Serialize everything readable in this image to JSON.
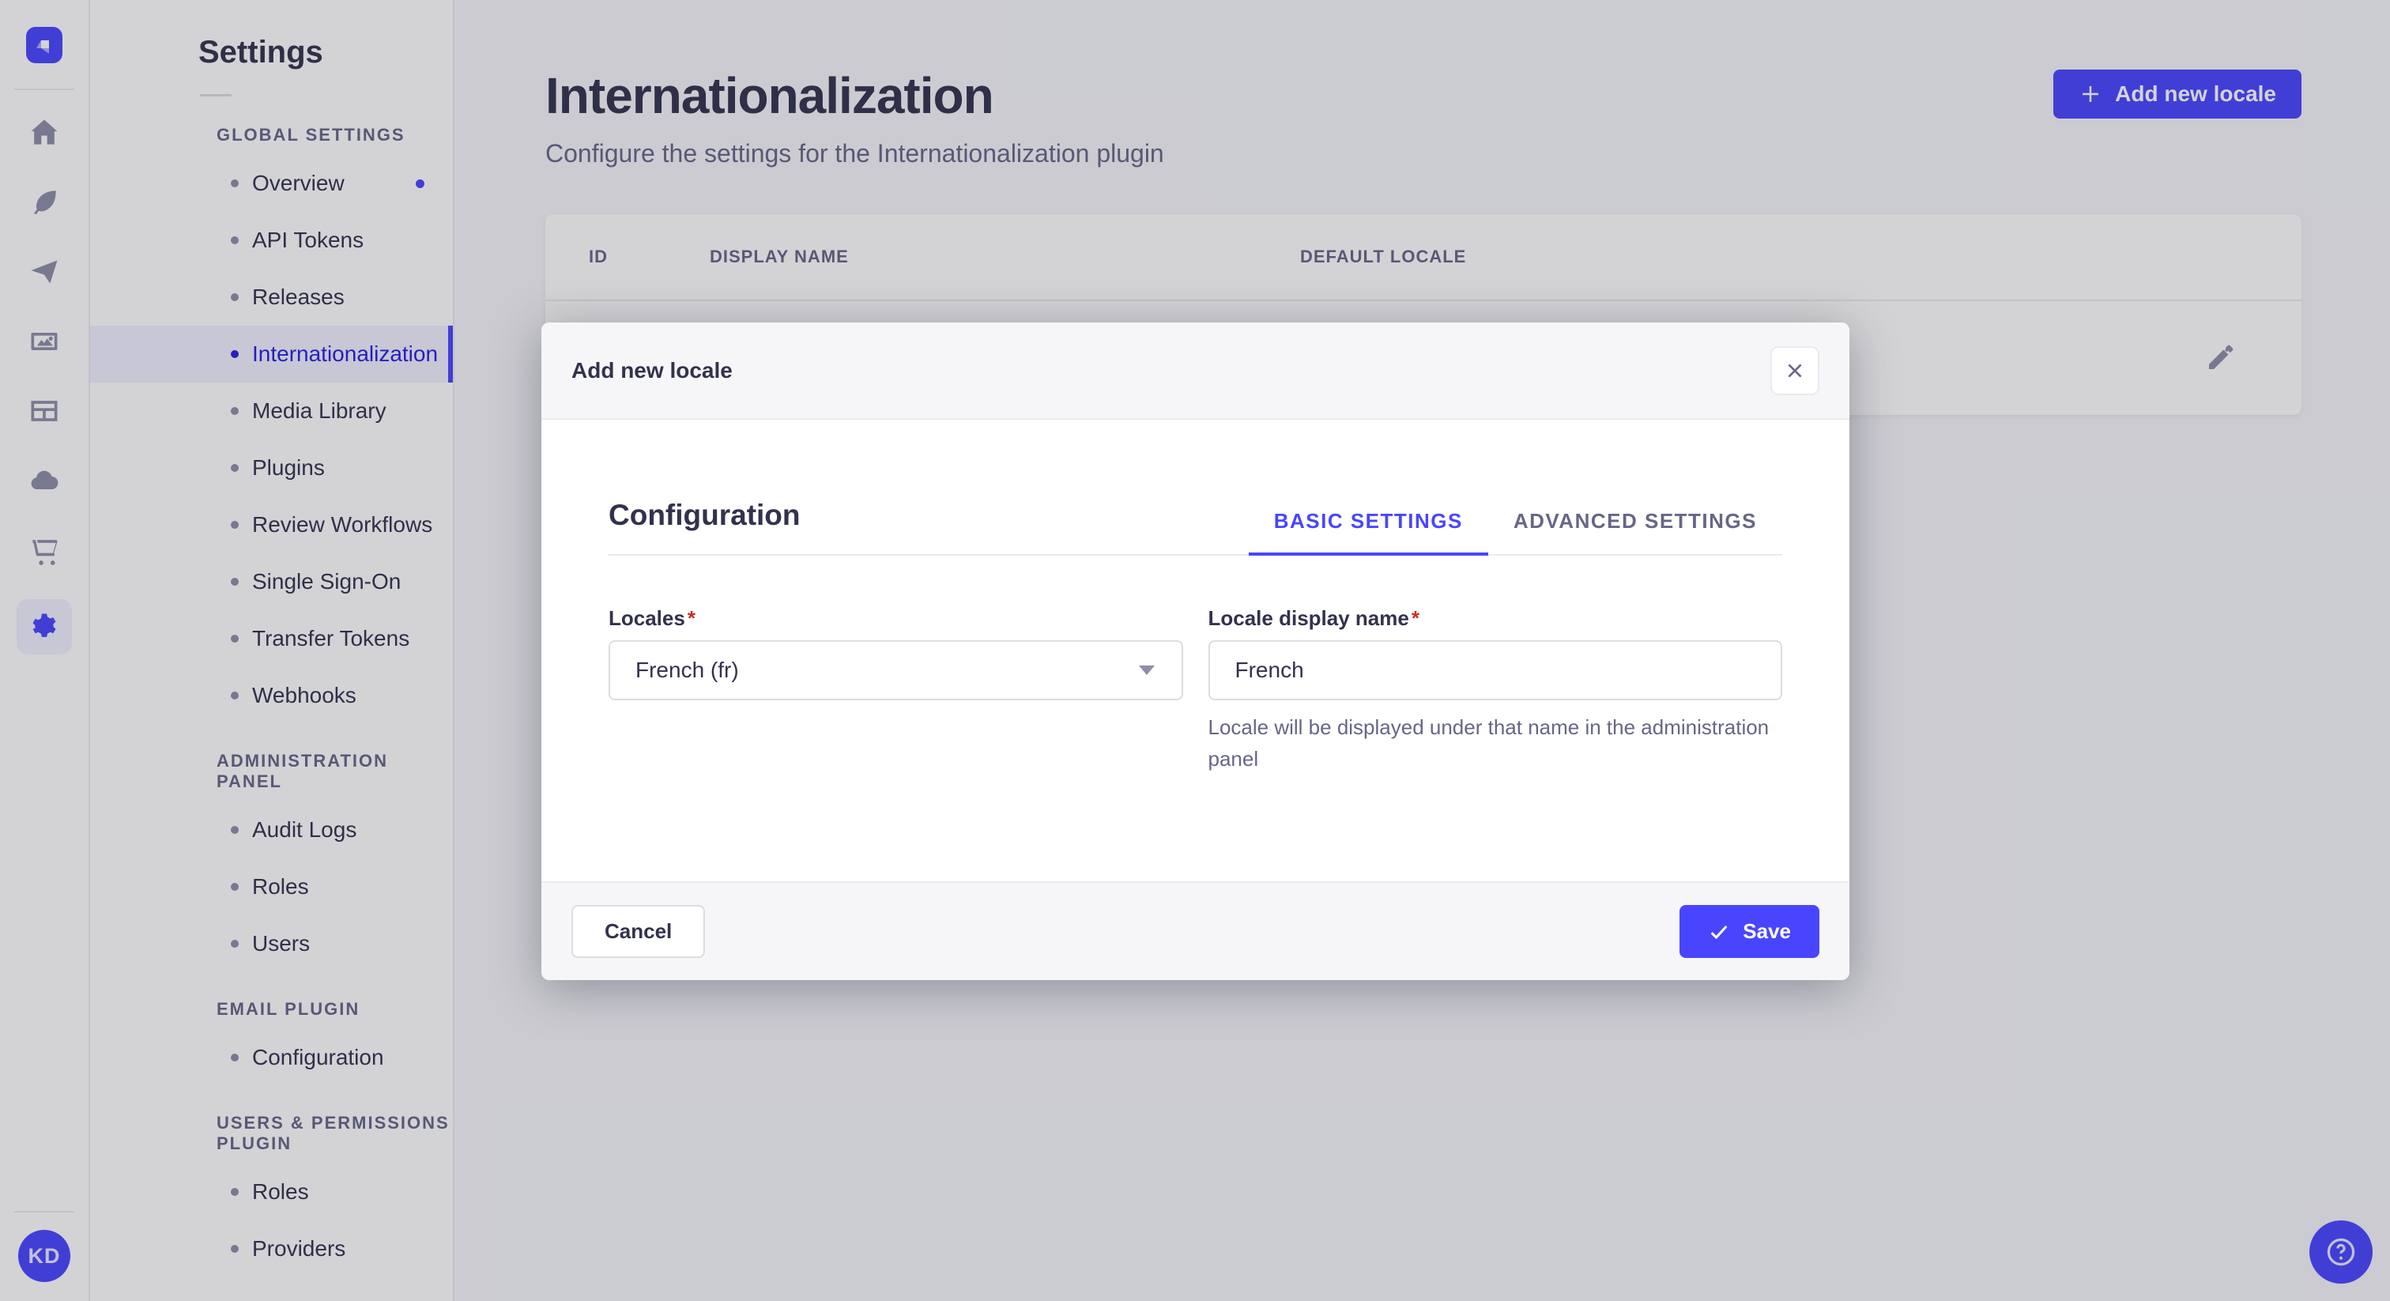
{
  "colors": {
    "primary": "#4945ff",
    "primary_dark": "#271fe0",
    "danger": "#d02b20"
  },
  "nav_rail": {
    "logo": "strapi-logo",
    "icons": [
      "home-icon",
      "feather-icon",
      "paper-plane-icon",
      "media-icon",
      "layout-icon",
      "cloud-icon",
      "cart-icon",
      "gear-icon"
    ],
    "avatar_initials": "KD"
  },
  "sidebar": {
    "title": "Settings",
    "sections": [
      {
        "label": "GLOBAL SETTINGS",
        "items": [
          {
            "label": "Overview",
            "has_dot": true
          },
          {
            "label": "API Tokens"
          },
          {
            "label": "Releases"
          },
          {
            "label": "Internationalization",
            "active": true
          },
          {
            "label": "Media Library"
          },
          {
            "label": "Plugins"
          },
          {
            "label": "Review Workflows"
          },
          {
            "label": "Single Sign-On"
          },
          {
            "label": "Transfer Tokens"
          },
          {
            "label": "Webhooks"
          }
        ]
      },
      {
        "label": "ADMINISTRATION PANEL",
        "items": [
          {
            "label": "Audit Logs"
          },
          {
            "label": "Roles"
          },
          {
            "label": "Users"
          }
        ]
      },
      {
        "label": "EMAIL PLUGIN",
        "items": [
          {
            "label": "Configuration"
          }
        ]
      },
      {
        "label": "USERS & PERMISSIONS PLUGIN",
        "items": [
          {
            "label": "Roles"
          },
          {
            "label": "Providers"
          }
        ]
      }
    ]
  },
  "page": {
    "title": "Internationalization",
    "subtitle": "Configure the settings for the Internationalization plugin",
    "add_button": "Add new locale",
    "table": {
      "columns": [
        "ID",
        "DISPLAY NAME",
        "DEFAULT LOCALE"
      ]
    }
  },
  "modal": {
    "title": "Add new locale",
    "section_title": "Configuration",
    "tabs": [
      {
        "label": "BASIC SETTINGS",
        "active": true
      },
      {
        "label": "ADVANCED SETTINGS"
      }
    ],
    "locales": {
      "label": "Locales",
      "required": "*",
      "value": "French (fr)"
    },
    "display_name": {
      "label": "Locale display name",
      "required": "*",
      "value": "French",
      "hint": "Locale will be displayed under that name in the administration panel"
    },
    "cancel_label": "Cancel",
    "save_label": "Save"
  }
}
